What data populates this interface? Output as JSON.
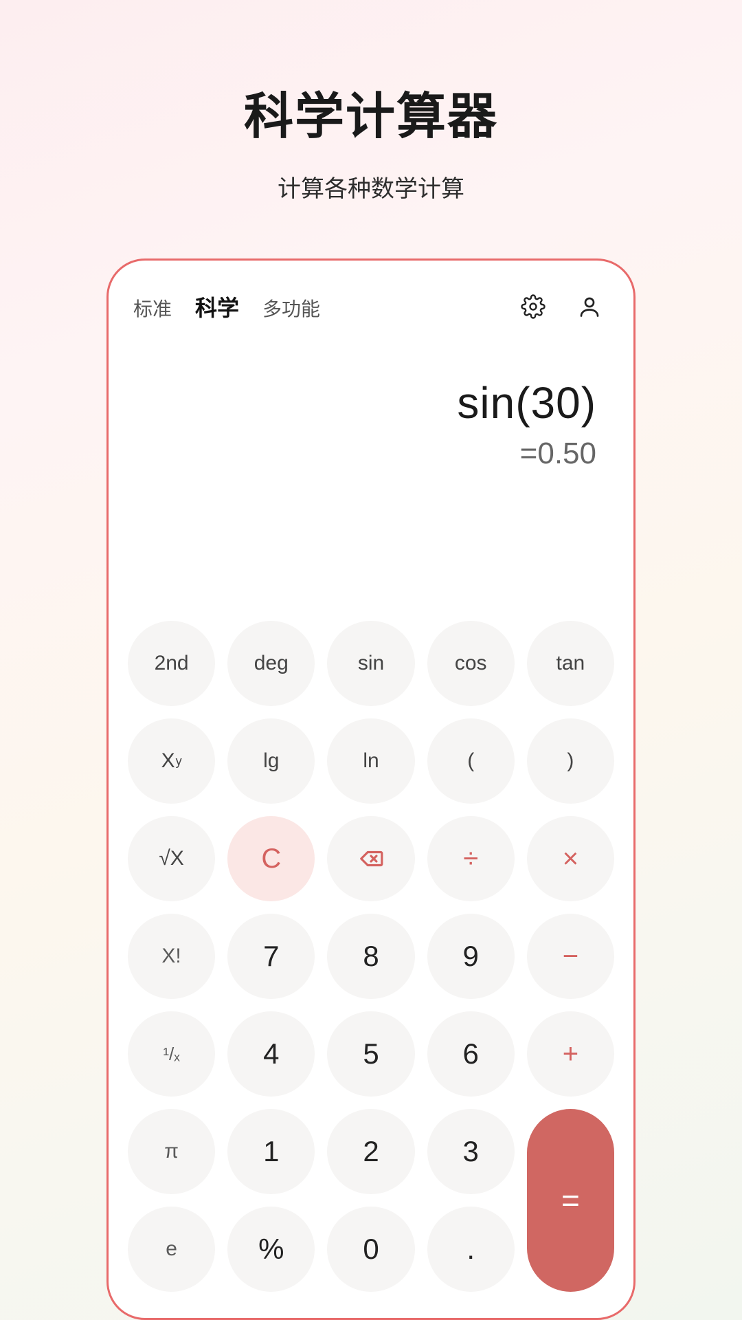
{
  "page": {
    "title": "科学计算器",
    "subtitle": "计算各种数学计算"
  },
  "tabs": [
    {
      "label": "标准",
      "active": false
    },
    {
      "label": "科学",
      "active": true
    },
    {
      "label": "多功能",
      "active": false
    }
  ],
  "icons": {
    "settings": "gear-icon",
    "profile": "person-icon",
    "backspace": "backspace-icon"
  },
  "display": {
    "expression": "sin(30)",
    "result": "=0.50"
  },
  "keys": {
    "second": "2nd",
    "deg": "deg",
    "sin": "sin",
    "cos": "cos",
    "tan": "tan",
    "xy_base": "X",
    "xy_exp": "y",
    "lg": "lg",
    "ln": "ln",
    "lparen": "(",
    "rparen": ")",
    "sqrt": "√X",
    "clear": "C",
    "divide": "÷",
    "multiply": "×",
    "factorial": "X!",
    "d7": "7",
    "d8": "8",
    "d9": "9",
    "minus": "−",
    "recip": "¹/ₓ",
    "d4": "4",
    "d5": "5",
    "d6": "6",
    "plus": "+",
    "pi": "π",
    "d1": "1",
    "d2": "2",
    "d3": "3",
    "equals": "=",
    "e": "e",
    "percent": "%",
    "d0": "0",
    "dot": "."
  },
  "colors": {
    "accent": "#d06762",
    "accent_light": "#fbe7e5",
    "key_bg": "#f6f5f4",
    "phone_border": "#e86a6a"
  }
}
